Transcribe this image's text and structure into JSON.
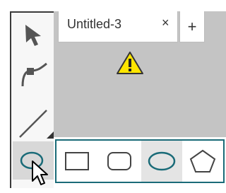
{
  "tab": {
    "title": "Untitled-3",
    "close_glyph": "×",
    "add_glyph": "+"
  },
  "icons": {
    "warning": "warning-triangle-icon",
    "select": "arrow-select-icon",
    "curve": "curve-pen-icon",
    "line": "line-icon",
    "ellipse": "ellipse-icon"
  },
  "flyout": {
    "shapes": [
      "rectangle",
      "rounded-rectangle",
      "ellipse",
      "pentagon"
    ],
    "selected": "ellipse"
  },
  "colors": {
    "accent": "#1a6b78",
    "canvas": "#c4c4c4",
    "warning_fill": "#ffe600"
  }
}
